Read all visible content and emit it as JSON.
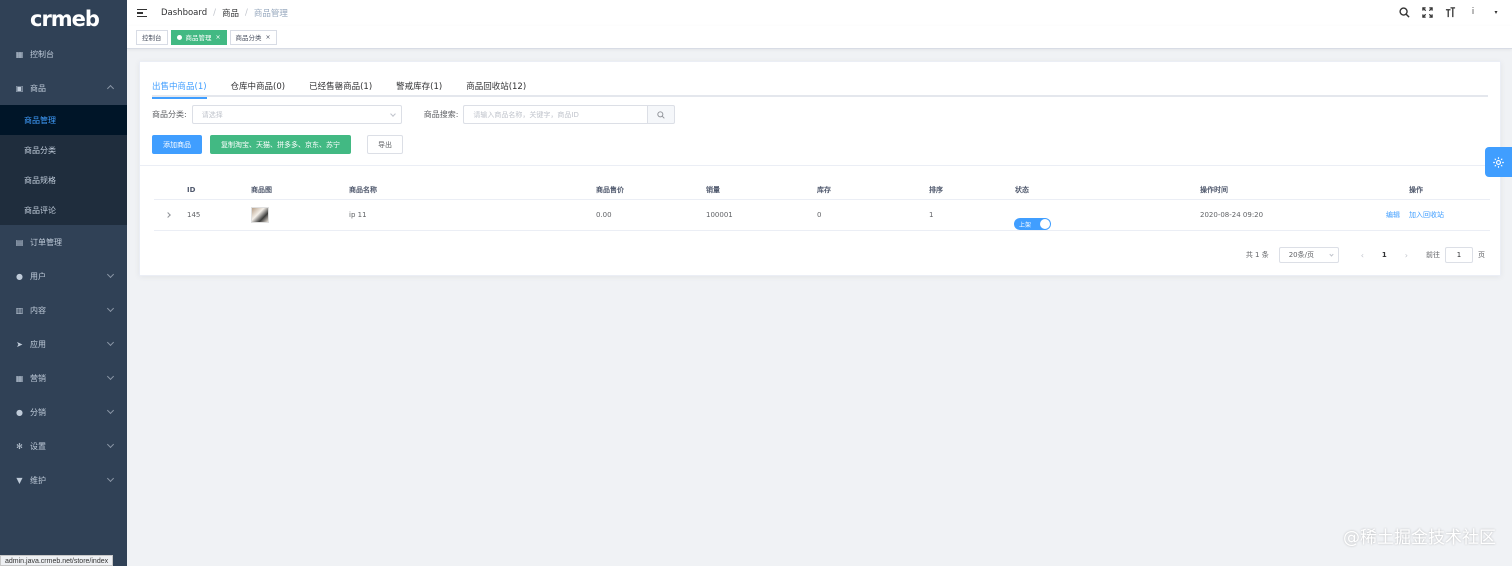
{
  "app": {
    "logo": "crmeb"
  },
  "sidebar": {
    "items": [
      {
        "label": "控制台",
        "icon": "dashboard-icon"
      },
      {
        "label": "商品",
        "icon": "goods-icon",
        "expanded": true,
        "children": [
          {
            "label": "商品管理",
            "active": true
          },
          {
            "label": "商品分类"
          },
          {
            "label": "商品规格"
          },
          {
            "label": "商品评论"
          }
        ]
      },
      {
        "label": "订单管理",
        "icon": "order-icon"
      },
      {
        "label": "用户",
        "icon": "user-icon"
      },
      {
        "label": "内容",
        "icon": "content-icon"
      },
      {
        "label": "应用",
        "icon": "app-icon"
      },
      {
        "label": "营销",
        "icon": "marketing-icon"
      },
      {
        "label": "分销",
        "icon": "distribution-icon"
      },
      {
        "label": "设置",
        "icon": "gear-icon"
      },
      {
        "label": "维护",
        "icon": "maintenance-icon"
      }
    ]
  },
  "status_url": "admin.java.crmeb.net/store/index",
  "header": {
    "breadcrumb": [
      "Dashboard",
      "商品",
      "商品管理"
    ],
    "avatar_text": "i"
  },
  "tags_view": [
    {
      "label": "控制台",
      "active": false
    },
    {
      "label": "商品管理",
      "active": true,
      "close": "×"
    },
    {
      "label": "商品分类",
      "active": false,
      "close": "×"
    }
  ],
  "tabs": [
    {
      "label": "出售中商品(1)",
      "active": true
    },
    {
      "label": "仓库中商品(0)"
    },
    {
      "label": "已经售罄商品(1)"
    },
    {
      "label": "警戒库存(1)"
    },
    {
      "label": "商品回收站(12)"
    }
  ],
  "filters": {
    "category_label": "商品分类:",
    "category_placeholder": "请选择",
    "search_label": "商品搜索:",
    "search_placeholder": "请输入商品名称，关键字，商品ID"
  },
  "buttons": {
    "add": "添加商品",
    "copy": "复制淘宝、天猫、拼多多、京东、苏宁",
    "export": "导出"
  },
  "table": {
    "columns": [
      "ID",
      "商品图",
      "商品名称",
      "商品售价",
      "销量",
      "库存",
      "排序",
      "状态",
      "操作时间",
      "操作"
    ],
    "rows": [
      {
        "id": "145",
        "name": "ip 11",
        "price": "0.00",
        "sales": "100001",
        "stock": "0",
        "sort": "1",
        "status": "上架",
        "status_on": true,
        "time": "2020-08-24 09:20",
        "actions": [
          "编辑",
          "加入回收站"
        ]
      }
    ]
  },
  "pagination": {
    "total": "共 1 条",
    "page_size": "20条/页",
    "current": "1",
    "goto_label": "前往",
    "goto_value": "1",
    "page_suffix": "页"
  },
  "watermark": "@稀土掘金技术社区",
  "colors": {
    "sidebar_bg": "#304156",
    "primary": "#409eff",
    "success": "#42b983"
  }
}
